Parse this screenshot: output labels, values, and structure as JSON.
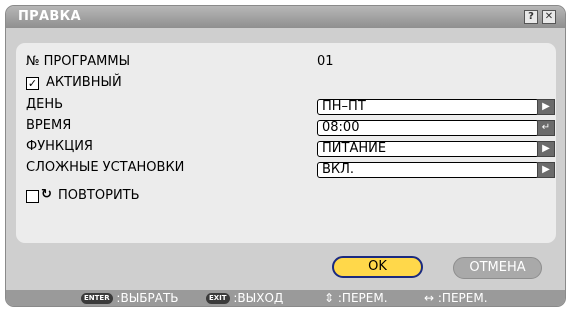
{
  "dialog": {
    "title": "ПРАВКА",
    "help_label": "?",
    "close_label": "✕"
  },
  "form": {
    "program_label": "№ ПРОГРАММЫ",
    "program_value": "01",
    "active_label": "АКТИВНЫЙ",
    "active_checked": true,
    "day_label": "ДЕНЬ",
    "day_value": "ПН–ПТ",
    "time_label": "ВРЕМЯ",
    "time_value": "08:00",
    "function_label": "ФУНКЦИЯ",
    "function_value": "ПИТАНИЕ",
    "advanced_label": "СЛОЖНЫЕ УСТАНОВКИ",
    "advanced_value": "ВКЛ.",
    "repeat_label": "ПОВТОРИТЬ",
    "repeat_checked": false
  },
  "buttons": {
    "ok": "OK",
    "cancel": "ОТМЕНА"
  },
  "footer": {
    "enter_key": "ENTER",
    "enter_text": ":ВЫБРАТЬ",
    "exit_key": "EXIT",
    "exit_text": ":ВЫХОД",
    "updown_icon": "⇕",
    "updown_text": ":ПЕРЕМ.",
    "leftright_icon": "↔",
    "leftright_text": ":ПЕРЕМ."
  },
  "colors": {
    "ok_button": "#ffd84a",
    "ok_border": "#1a2a80",
    "cancel_button": "#a9a9a9",
    "title_bar": "#9a9a9a"
  }
}
